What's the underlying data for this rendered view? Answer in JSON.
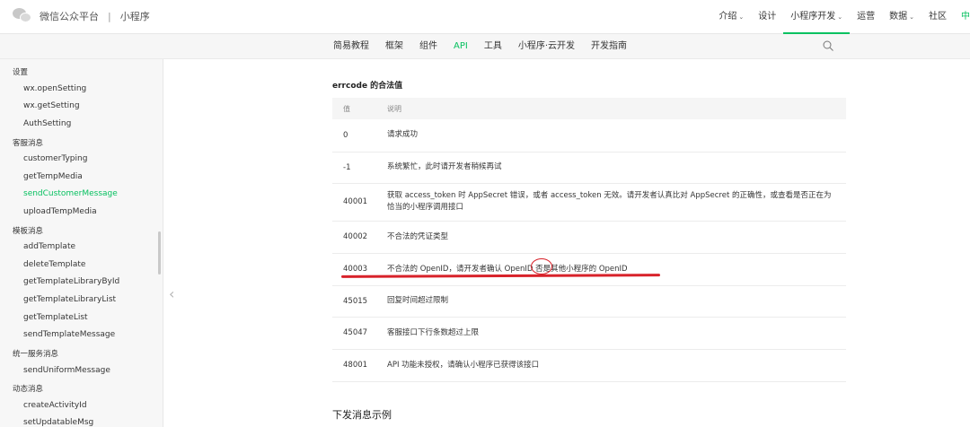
{
  "header": {
    "brand": "微信公众平台",
    "separator": "|",
    "product": "小程序",
    "nav": [
      {
        "label": "介绍",
        "caret": "⌄"
      },
      {
        "label": "设计",
        "caret": ""
      },
      {
        "label": "小程序开发",
        "caret": "⌄"
      },
      {
        "label": "运营",
        "caret": ""
      },
      {
        "label": "数据",
        "caret": "⌄"
      },
      {
        "label": "社区",
        "caret": ""
      },
      {
        "label": "中",
        "caret": ""
      }
    ]
  },
  "subnav": {
    "items": [
      "简易教程",
      "框架",
      "组件",
      "API",
      "工具",
      "小程序·云开发",
      "开发指南"
    ],
    "active": "API"
  },
  "sidebar": {
    "items": [
      {
        "label": "设置",
        "type": "group"
      },
      {
        "label": "wx.openSetting",
        "type": "child"
      },
      {
        "label": "wx.getSetting",
        "type": "child"
      },
      {
        "label": "AuthSetting",
        "type": "child"
      },
      {
        "label": "客服消息",
        "type": "group"
      },
      {
        "label": "customerTyping",
        "type": "child"
      },
      {
        "label": "getTempMedia",
        "type": "child"
      },
      {
        "label": "sendCustomerMessage",
        "type": "child",
        "active": true
      },
      {
        "label": "uploadTempMedia",
        "type": "child"
      },
      {
        "label": "模板消息",
        "type": "group"
      },
      {
        "label": "addTemplate",
        "type": "child"
      },
      {
        "label": "deleteTemplate",
        "type": "child"
      },
      {
        "label": "getTemplateLibraryById",
        "type": "child"
      },
      {
        "label": "getTemplateLibraryList",
        "type": "child"
      },
      {
        "label": "getTemplateList",
        "type": "child"
      },
      {
        "label": "sendTemplateMessage",
        "type": "child"
      },
      {
        "label": "统一服务消息",
        "type": "group"
      },
      {
        "label": "sendUniformMessage",
        "type": "child"
      },
      {
        "label": "动态消息",
        "type": "group"
      },
      {
        "label": "createActivityId",
        "type": "child"
      },
      {
        "label": "setUpdatableMsg",
        "type": "child"
      }
    ]
  },
  "content": {
    "section_title": "errcode 的合法值",
    "table": {
      "headers": [
        "值",
        "说明"
      ],
      "rows": [
        [
          "0",
          "请求成功"
        ],
        [
          "-1",
          "系统繁忙，此时请开发者稍候再试"
        ],
        [
          "40001",
          "获取 access_token 时 AppSecret 错误，或者 access_token 无效。请开发者认真比对 AppSecret 的正确性，或查看是否正在为恰当的小程序调用接口"
        ],
        [
          "40002",
          "不合法的凭证类型"
        ],
        [
          "40003",
          "不合法的 OpenID，请开发者确认 OpenID 否是其他小程序的 OpenID"
        ],
        [
          "45015",
          "回复时间超过限制"
        ],
        [
          "45047",
          "客服接口下行条数超过上限"
        ],
        [
          "48001",
          "API 功能未授权，请确认小程序已获得该接口"
        ]
      ]
    },
    "example_title": "下发消息示例"
  },
  "colors": {
    "accent": "#07c160",
    "annotation": "#d8222a"
  }
}
